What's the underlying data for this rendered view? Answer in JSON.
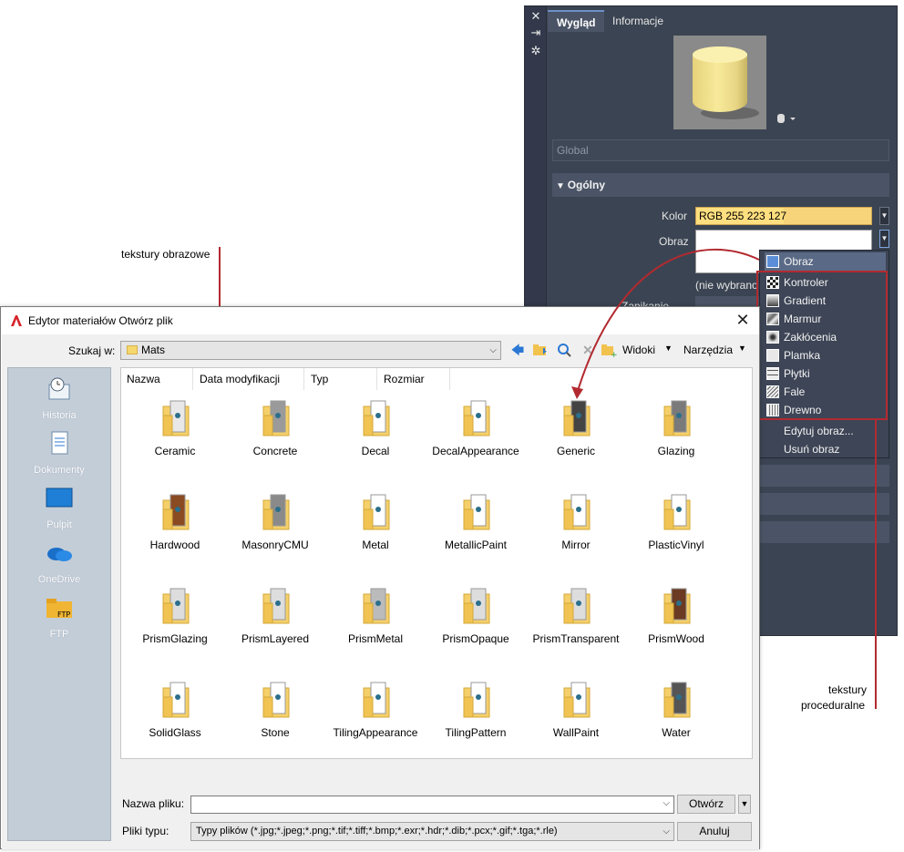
{
  "annotations": {
    "image_textures": "tekstury obrazowe",
    "procedural_line1": "tekstury",
    "procedural_line2": "proceduralne"
  },
  "material_panel": {
    "tabs": [
      "Wygląd",
      "Informacje"
    ],
    "active_tab": "Wygląd",
    "global_field": "Global",
    "section_title": "Ogólny",
    "color_label": "Kolor",
    "color_value": "RGB 255 223 127",
    "image_label": "Obraz",
    "not_selected_text": "(nie wybrano",
    "partial_label": "Zanikanie",
    "icons": [
      "close-icon",
      "pin-icon",
      "settings-icon"
    ],
    "colors": {
      "panel_bg": "#3b4452",
      "color_swatch": "#ffdf7f"
    }
  },
  "image_menu": {
    "items": [
      {
        "label": "Obraz",
        "icon": "image-icon",
        "selected": true
      },
      {
        "label": "Kontroler",
        "icon": "checker-icon"
      },
      {
        "label": "Gradient",
        "icon": "gradient-icon"
      },
      {
        "label": "Marmur",
        "icon": "marble-icon"
      },
      {
        "label": "Zakłócenia",
        "icon": "noise-icon"
      },
      {
        "label": "Plamka",
        "icon": "speckle-icon"
      },
      {
        "label": "Płytki",
        "icon": "tiles-icon"
      },
      {
        "label": "Fale",
        "icon": "waves-icon"
      },
      {
        "label": "Drewno",
        "icon": "wood-icon"
      },
      {
        "label": "Edytuj obraz..."
      },
      {
        "label": "Usuń obraz"
      }
    ]
  },
  "dialog": {
    "title": "Edytor materiałów Otwórz plik",
    "look_in_label": "Szukaj w:",
    "look_in_value": "Mats",
    "views_label": "Widoki",
    "tools_label": "Narzędzia",
    "places": [
      {
        "label": "Historia",
        "icon": "history-icon"
      },
      {
        "label": "Dokumenty",
        "icon": "documents-icon"
      },
      {
        "label": "Pulpit",
        "icon": "desktop-icon"
      },
      {
        "label": "OneDrive",
        "icon": "onedrive-icon"
      },
      {
        "label": "FTP",
        "icon": "ftp-folder-icon"
      }
    ],
    "columns": [
      "Nazwa",
      "Data modyfikacji",
      "Typ",
      "Rozmiar"
    ],
    "folders": [
      "Ceramic",
      "Concrete",
      "Decal",
      "DecalAppearance",
      "Generic",
      "Glazing",
      "Hardwood",
      "MasonryCMU",
      "Metal",
      "MetallicPaint",
      "Mirror",
      "PlasticVinyl",
      "PrismGlazing",
      "PrismLayered",
      "PrismMetal",
      "PrismOpaque",
      "PrismTransparent",
      "PrismWood",
      "SolidGlass",
      "Stone",
      "TilingAppearance",
      "TilingPattern",
      "WallPaint",
      "Water"
    ],
    "filename_label": "Nazwa pliku:",
    "filename_value": "",
    "filetype_label": "Pliki typu:",
    "filetype_value": "Typy plików  (*.jpg;*.jpeg;*.png;*.tif;*.tiff;*.bmp;*.exr;*.hdr;*.dib;*.pcx;*.gif;*.tga;*.rle)",
    "open_button": "Otwórz",
    "cancel_button": "Anuluj"
  }
}
